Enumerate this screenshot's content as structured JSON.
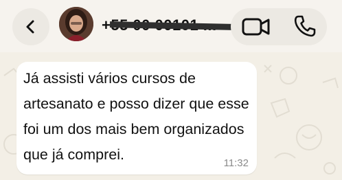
{
  "header": {
    "back_icon": "chevron-left-icon",
    "contact_name": "+55 00 00101 ...",
    "video_icon": "video-camera-icon",
    "phone_icon": "phone-icon"
  },
  "message": {
    "text": "Já assisti vários cursos de artesanato e posso dizer que esse foi um dos mais bem organizados que já comprei.",
    "time": "11:32"
  },
  "colors": {
    "background": "#f3efe6",
    "header": "#f6f3ee",
    "bubble": "#ffffff"
  }
}
